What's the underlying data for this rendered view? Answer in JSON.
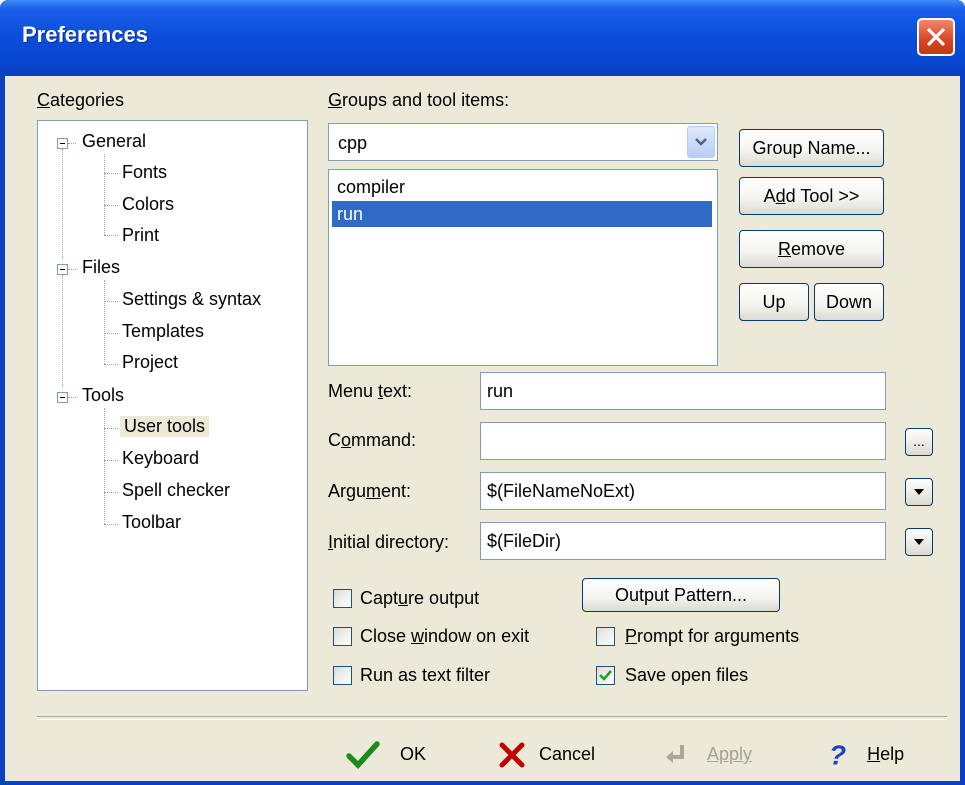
{
  "window": {
    "title": "Preferences"
  },
  "categories": {
    "label": "Categories",
    "tree": [
      {
        "label": "General",
        "children": [
          "Fonts",
          "Colors",
          "Print"
        ]
      },
      {
        "label": "Files",
        "children": [
          "Settings & syntax",
          "Templates",
          "Project"
        ]
      },
      {
        "label": "Tools",
        "children": [
          "User tools",
          "Keyboard",
          "Spell checker",
          "Toolbar"
        ]
      }
    ],
    "selected": "User tools"
  },
  "groups": {
    "label": "Groups and tool items:",
    "combo_value": "cpp",
    "items": [
      "compiler",
      "run"
    ],
    "selected_item": "run",
    "buttons": {
      "group_name": "Group Name...",
      "add_tool": "Add Tool >>",
      "remove": "Remove",
      "up": "Up",
      "down": "Down"
    }
  },
  "fields": {
    "menu_text_label": "Menu text:",
    "menu_text_value": "run",
    "command_label": "Command:",
    "command_value": "",
    "command_browse": "...",
    "argument_label": "Argument:",
    "argument_value": "$(FileNameNoExt)",
    "initial_dir_label": "Initial directory:",
    "initial_dir_value": "$(FileDir)"
  },
  "options": {
    "capture_output": {
      "label": "Capture output",
      "checked": false
    },
    "close_window": {
      "label": "Close window on exit",
      "checked": false
    },
    "run_text_filter": {
      "label": "Run as text filter",
      "checked": false
    },
    "prompt_args": {
      "label": "Prompt for arguments",
      "checked": false
    },
    "save_open_files": {
      "label": "Save open files",
      "checked": true
    },
    "output_pattern": "Output Pattern..."
  },
  "footer": {
    "ok": "OK",
    "cancel": "Cancel",
    "apply": "Apply",
    "help": "Help"
  },
  "colors": {
    "title_blue": "#0b4fdc",
    "selection": "#316ac5",
    "face": "#ece9d8"
  }
}
